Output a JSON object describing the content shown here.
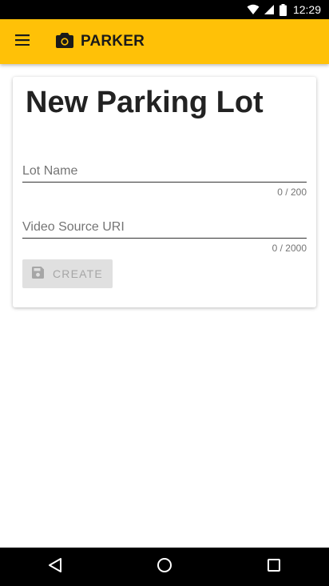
{
  "status_bar": {
    "time": "12:29",
    "icons": [
      "wifi-icon",
      "signal-icon",
      "battery-icon"
    ]
  },
  "app_bar": {
    "menu_icon": "menu-icon",
    "logo_icon": "camera-icon",
    "title": "PARKER",
    "color": "#FFC107"
  },
  "form": {
    "heading": "New Parking Lot",
    "lot_name": {
      "placeholder": "Lot Name",
      "value": "",
      "counter": "0 / 200"
    },
    "video_uri": {
      "placeholder": "Video Source URI",
      "value": "",
      "counter": "0 / 2000"
    },
    "create_button": {
      "icon": "save-icon",
      "label": "CREATE",
      "disabled": true
    }
  },
  "nav_bar": {
    "icons": [
      "back-icon",
      "home-icon",
      "recents-icon"
    ]
  }
}
